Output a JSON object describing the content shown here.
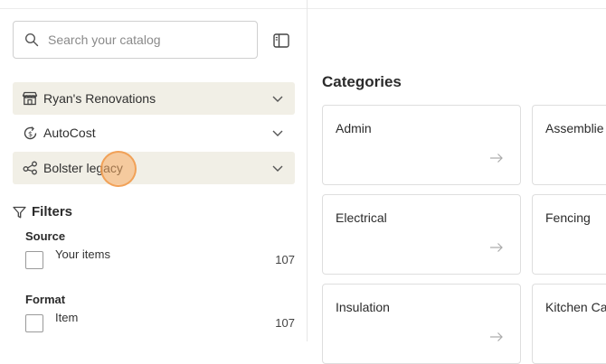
{
  "search": {
    "placeholder": "Search your catalog"
  },
  "groups": [
    {
      "label": "Ryan's Renovations"
    },
    {
      "label": "AutoCost"
    },
    {
      "label": "Bolster legacy"
    }
  ],
  "filters": {
    "label": "Filters",
    "sections": [
      {
        "title": "Source",
        "option": "Your items",
        "count": "107"
      },
      {
        "title": "Format",
        "option": "Item",
        "count": "107"
      }
    ]
  },
  "categories": {
    "title": "Categories",
    "items": [
      "Admin",
      "Assemblie",
      "Electrical",
      "Fencing",
      "Insulation",
      "Kitchen Ca"
    ]
  }
}
